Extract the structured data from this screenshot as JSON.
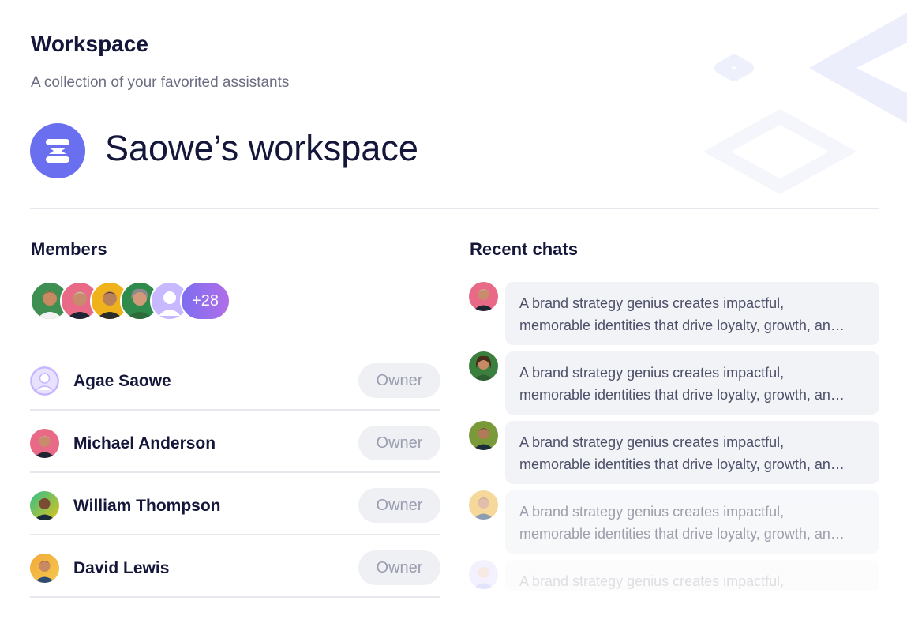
{
  "header": {
    "title": "Workspace",
    "subtitle": "A collection of your favorited assistants"
  },
  "workspace": {
    "name": "Saowe’s workspace",
    "logo_icon": "workspace-logo-icon",
    "logo_color": "#6a6ff0"
  },
  "members": {
    "heading": "Members",
    "avatar_stack": [
      {
        "name": "avatar-1",
        "bg": "#3f8f52",
        "skin": "#c98a63",
        "hair": "#2b1f18"
      },
      {
        "name": "avatar-2",
        "bg": "#e86a86",
        "skin": "#c78c6c",
        "hair": "#cfcfcf"
      },
      {
        "name": "avatar-3",
        "bg": "#f0b21a",
        "skin": "#b9805c",
        "hair": "#3b2a22"
      },
      {
        "name": "avatar-4",
        "bg": "#2f8b4c",
        "skin": "#d29a7a",
        "hair": "#8a8a8a"
      },
      {
        "name": "avatar-5-placeholder",
        "bg": "#c7b8ff",
        "skin": "#ffffff",
        "hair": "#c7b8ff"
      }
    ],
    "more_count": "+28",
    "list": [
      {
        "name": "Agae Saowe",
        "role": "Owner",
        "avatar": "placeholder"
      },
      {
        "name": "Michael Anderson",
        "role": "Owner",
        "avatar": "photo"
      },
      {
        "name": "William Thompson",
        "role": "Owner",
        "avatar": "photo"
      },
      {
        "name": "David Lewis",
        "role": "Owner",
        "avatar": "photo"
      }
    ]
  },
  "recent_chats": {
    "heading": "Recent chats",
    "items": [
      {
        "line1": "A brand strategy genius creates impactful,",
        "line2": "memorable identities that drive loyalty, growth, an…"
      },
      {
        "line1": "A brand strategy genius creates impactful,",
        "line2": "memorable identities that drive loyalty, growth, an…"
      },
      {
        "line1": "A brand strategy genius creates impactful,",
        "line2": "memorable identities that drive loyalty, growth, an…"
      },
      {
        "line1": "A brand strategy genius creates impactful,",
        "line2": "memorable identities that drive loyalty, growth, an…"
      },
      {
        "line1": "A brand strategy genius creates impactful,",
        "line2": ""
      }
    ]
  }
}
